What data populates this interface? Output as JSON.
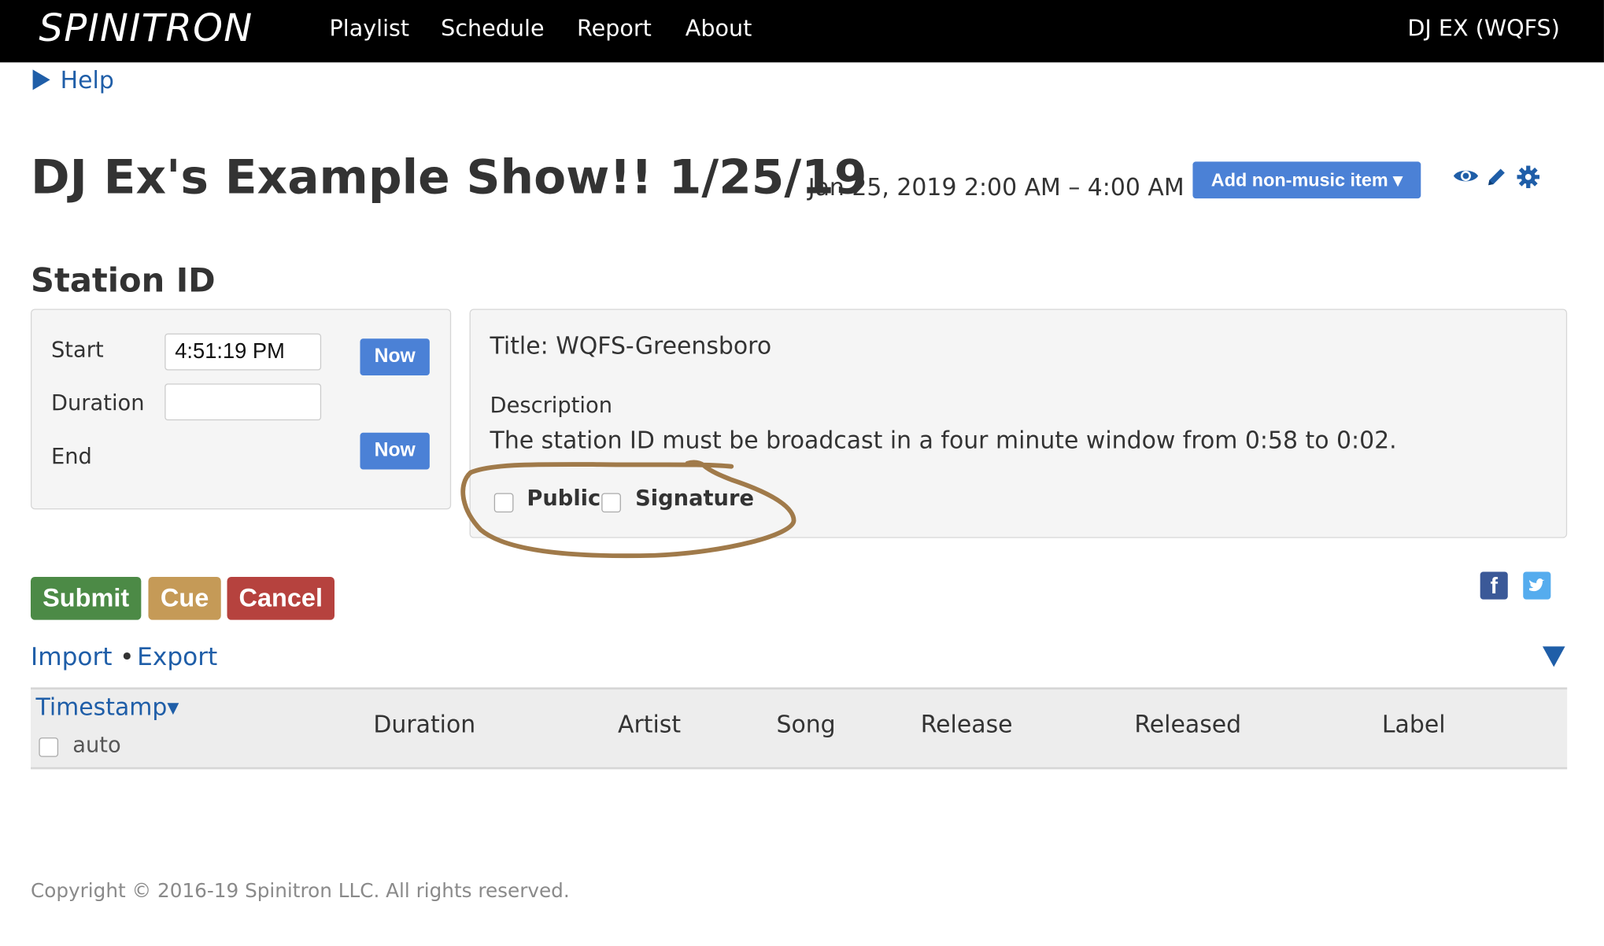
{
  "nav": {
    "brand": "SPINITRON",
    "links": [
      "Playlist",
      "Schedule",
      "Report",
      "About"
    ],
    "user": "DJ EX (WQFS)"
  },
  "help_label": "Help",
  "show": {
    "title": "DJ Ex's Example Show!! 1/25/19",
    "time": "Jan 25, 2019 2:00 AM – 4:00 AM",
    "add_button": "Add non-music item ▾"
  },
  "icons": [
    "eye-icon",
    "pencil-icon",
    "gear-icon"
  ],
  "section_title": "Station ID",
  "form": {
    "start_label": "Start",
    "start_value": "4:51:19 PM",
    "duration_label": "Duration",
    "duration_value": "",
    "end_label": "End",
    "now_label": "Now"
  },
  "info": {
    "title_label": "Title:",
    "title_value": "WQFS-Greensboro",
    "description_label": "Description",
    "description_text": "The station ID must be broadcast in a four minute window from 0:58 to 0:02.",
    "public_label": "Public",
    "signature_label": "Signature"
  },
  "actions": {
    "submit": "Submit",
    "cue": "Cue",
    "cancel": "Cancel"
  },
  "colors": {
    "submit": "#4c8a46",
    "cue": "#c59a57",
    "cancel": "#b6423e",
    "facebook": "#3b5998",
    "twitter": "#55acee"
  },
  "links": {
    "import": "Import",
    "separator": "•",
    "export": "Export"
  },
  "table": {
    "timestamp": "Timestamp▾",
    "auto": "auto",
    "columns": [
      "Duration",
      "Artist",
      "Song",
      "Release",
      "Released",
      "Label"
    ]
  },
  "footer": "Copyright © 2016-19 Spinitron LLC. All rights reserved."
}
